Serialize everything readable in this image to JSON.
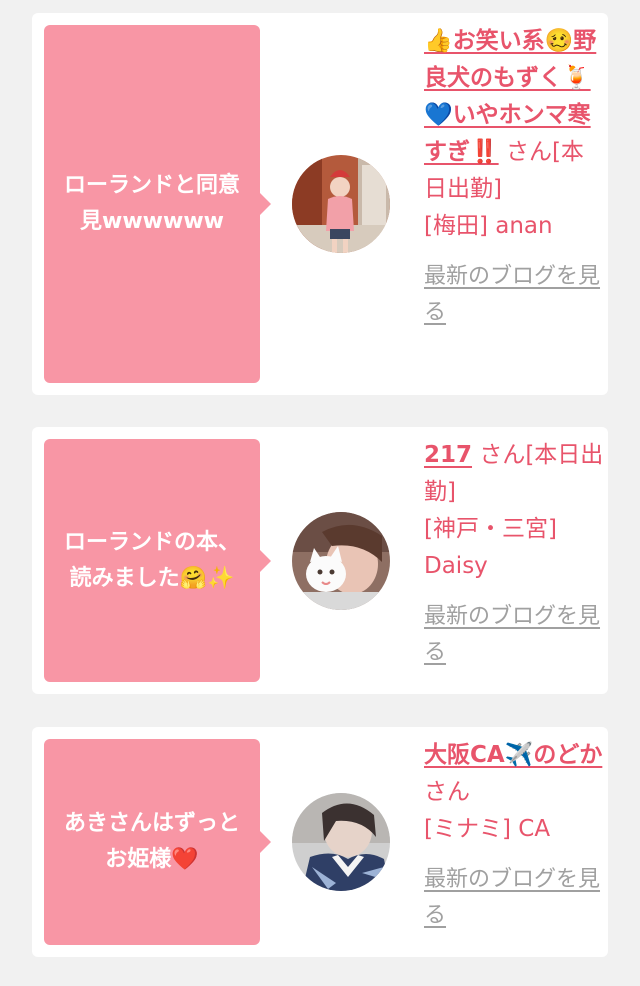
{
  "posts": [
    {
      "message": "ローランドと同意\n見wwwwww",
      "name": "👍お笑い系🥴野良犬のもずく🍹💙いやホンマ寒すぎ‼️",
      "status": "さん[本日出勤]",
      "area": "[梅田] anan",
      "blog_link": "最新のブログを見る",
      "avatar_icon": "girl-photo-avatar"
    },
    {
      "message": "ローランドの本、\n読みました🤗✨",
      "name": "217",
      "status": "さん[本日出勤]",
      "area": "[神戸・三宮] Daisy",
      "blog_link": "最新のブログを見る",
      "avatar_icon": "girl-with-cat-avatar"
    },
    {
      "message": "あきさんはずっと\nお姫様❤️",
      "name": "大阪CA✈️のどか",
      "status": "さん",
      "area": "[ミナミ] CA",
      "blog_link": "最新のブログを見る",
      "avatar_icon": "girl-uniform-avatar"
    }
  ],
  "colors": {
    "bubble": "#f896a5",
    "accent": "#e8546b",
    "link_gray": "#a0a0a0",
    "background": "#f1f1f1"
  }
}
